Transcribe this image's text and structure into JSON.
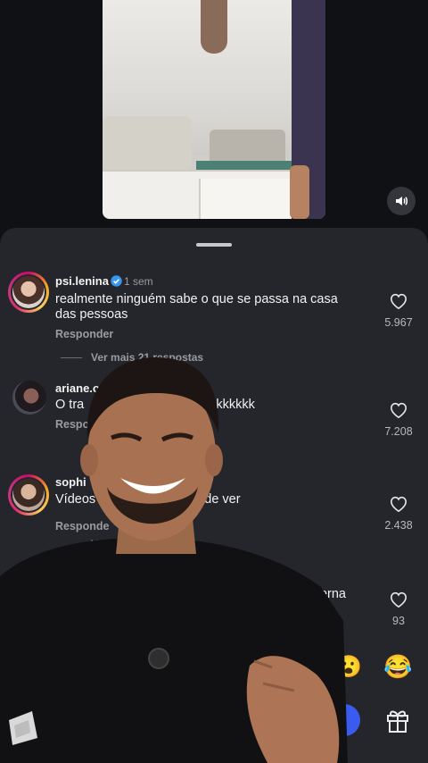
{
  "comments": [
    {
      "username": "psi.lenina",
      "verified": true,
      "time": "1 sem",
      "text_lines": [
        "realmente ninguém sabe o que se passa na casa",
        "das pessoas"
      ],
      "reply": "Responder",
      "more_replies": "Ver mais 21 respostas",
      "likes": "5.967",
      "avatar_color": "#c9a08a"
    },
    {
      "username": "ariane.o",
      "text_lines": [
        "O tra",
        "ão kkkkkkk"
      ],
      "reply": "Respo",
      "likes": "7.208",
      "avatar_color": "#5b3a3d"
    },
    {
      "username": "sophi",
      "text_lines": [
        "Vídeos",
        "s de ver"
      ],
      "reply": "Responde",
      "more_replies": "V",
      "likes": "2.438",
      "avatar_color": "#c7a185"
    },
    {
      "text_lines": [
        "r perna"
      ],
      "likes": "93"
    }
  ],
  "emojis": {
    "laugh": "😂",
    "partial": "😮"
  },
  "icons": {
    "volume": "speaker-icon",
    "heart": "heart-icon",
    "gift": "gift-icon",
    "verified": "verified-badge-icon"
  },
  "colors": {
    "sheet_bg": "#25262b",
    "verified_blue": "#3897f0",
    "send_blue": "#3a5bf0"
  }
}
